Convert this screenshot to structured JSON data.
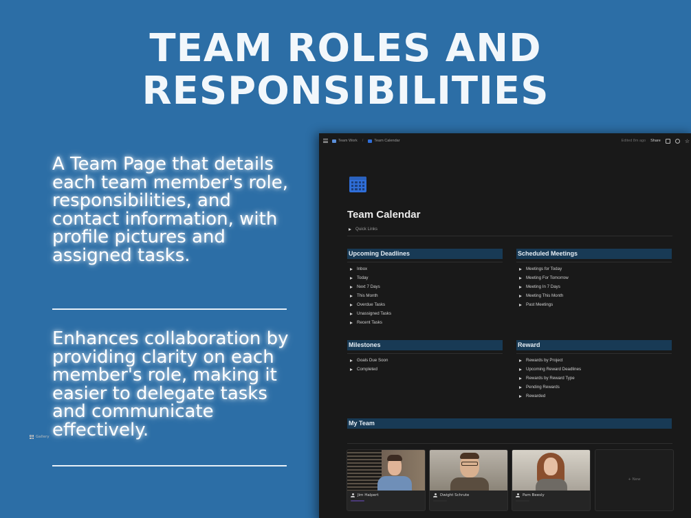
{
  "headline": {
    "line1": "TEAM ROLES AND",
    "line2": "RESPONSIBILITIES"
  },
  "description": {
    "para1": "A Team Page that details each team member's role, responsibilities, and contact information, with profile pictures and assigned tasks.",
    "para2": "Enhances collaboration by providing clarity on each member's role, making it easier to delegate tasks and communicate effectively."
  },
  "app": {
    "breadcrumb": [
      "Team Work",
      "Team Calendar"
    ],
    "edited": "Edited 8m ago",
    "share": "Share",
    "page_title": "Team Calendar",
    "quick_links": "Quick Links",
    "sections": {
      "upcoming": {
        "title": "Upcoming Deadlines",
        "items": [
          "Inbox",
          "Today",
          "Next 7 Days",
          "This Month",
          "Overdue Tasks",
          "Unassigned Tasks",
          "Recent Tasks"
        ]
      },
      "meetings": {
        "title": "Scheduled Meetings",
        "items": [
          "Meetings for Today",
          "Meeting For Tomorrow",
          "Meeting In 7 Days",
          "Meeting This Month",
          "Past Meetings"
        ]
      },
      "milestones": {
        "title": "Milestones",
        "items": [
          "Goals Due Soon",
          "Completed"
        ]
      },
      "reward": {
        "title": "Reward",
        "items": [
          "Rewards by Project",
          "Upcoming Reward Deadlines",
          "Rewards by Reward Type",
          "Pending Rewards",
          "Rewarded"
        ]
      }
    },
    "team": {
      "title": "My Team",
      "view_label": "Gallery",
      "members": [
        "Jim Halpert",
        "Dwight Schrute",
        "Pam Beesly"
      ],
      "new_label": "+ New"
    }
  },
  "colors": {
    "background": "#2c6ea6",
    "app_bg": "#191919",
    "section_header": "#183a55",
    "calendar_icon": "#2f6ed8"
  },
  "icons": [
    "menu-icon",
    "team-icon",
    "calendar-icon",
    "comment-icon",
    "clock-icon",
    "star-icon",
    "person-icon",
    "gallery-icon"
  ]
}
